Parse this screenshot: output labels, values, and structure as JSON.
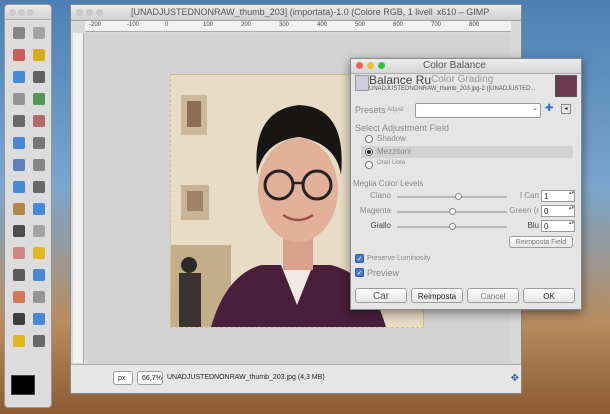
{
  "toolbox": {
    "tool_count": 30
  },
  "main_window": {
    "title": "[UNADJUSTEDNONRAW_thumb_203] (importata)-1.0 (Colore RGB, 1 livell",
    "title_suffix": "x610 – GIMP",
    "ruler_marks": [
      "-200",
      "-100",
      "0",
      "100",
      "200",
      "300",
      "400",
      "500",
      "600",
      "700",
      "800"
    ],
    "status": {
      "unit": "px",
      "zoom": "66,7%",
      "filename": "UNADJUSTEDNONRAW_thumb_203.jpg (4,3 MB)"
    }
  },
  "dialog": {
    "title": "Color Balance",
    "header_title": "Balance Ru",
    "header_overlay": "Color Grading",
    "header_subtitle": "UNADJUSTEDNONRAW_thumb_203.jpg-2 ([UNADJUSTED...",
    "presets_label": "Presets",
    "presets_sub": "Adjust",
    "select_field_label": "Select Adjustment Field",
    "ranges": [
      {
        "label": "Shadow",
        "selected": false
      },
      {
        "label": "Mezzitoni",
        "selected": true
      },
      {
        "label": "Orari Liore",
        "selected": false
      }
    ],
    "levels_label": "Meglia Color Levels",
    "sliders": [
      {
        "left": "Ciano",
        "right": "I Can",
        "value": "1",
        "position": 0.55
      },
      {
        "left": "Magenta",
        "right": "Green (r",
        "value": "0",
        "position": 0.5
      },
      {
        "left": "Giallo",
        "right": "Blu",
        "value": "0",
        "position": 0.5
      }
    ],
    "reset_field": "Reimposta Field",
    "preserve_label": "Preserve Luminosity",
    "preview_label": "Preview",
    "buttons": {
      "help": "Car",
      "reset": "Reimposta",
      "cancel": "Cancel",
      "ok": "OK"
    }
  }
}
